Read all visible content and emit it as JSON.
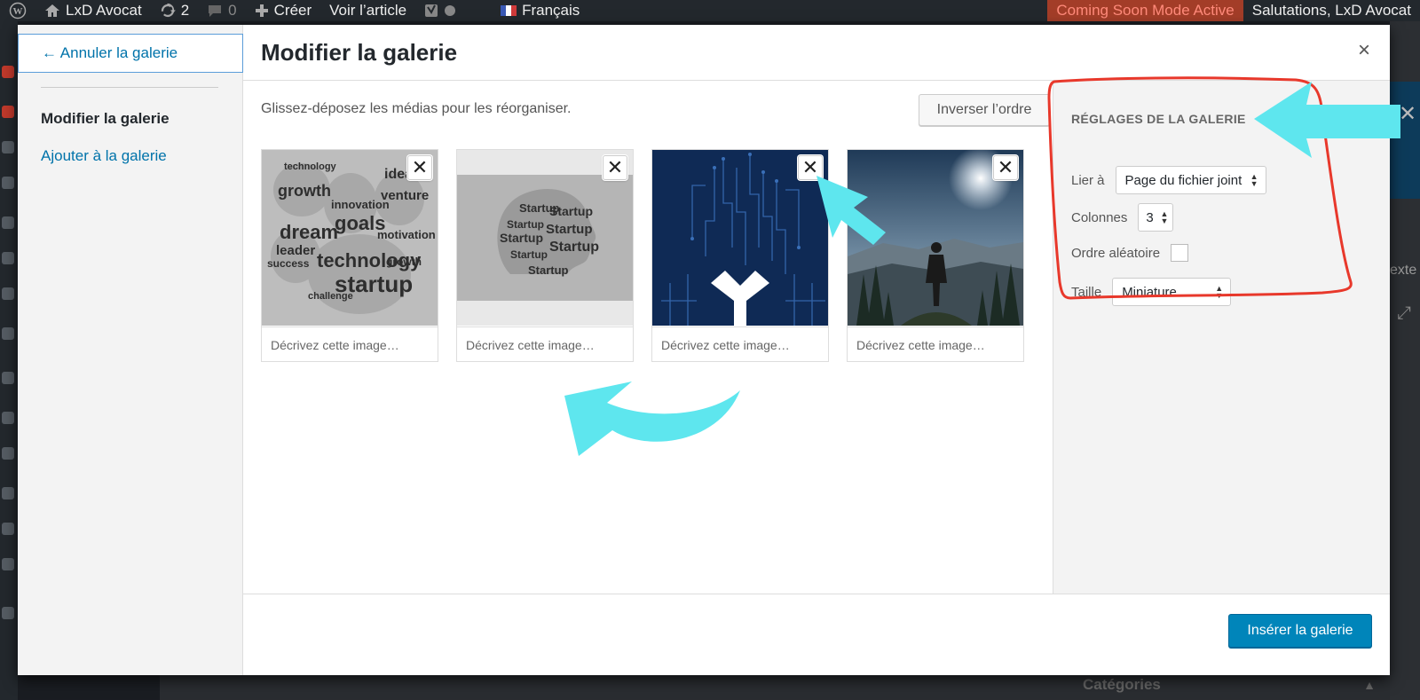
{
  "adminbar": {
    "site_name": "LxD Avocat",
    "updates_count": "2",
    "comments_count": "0",
    "new_label": "Créer",
    "view_label": "Voir l’article",
    "language": "Français",
    "coming_soon": "Coming Soon Mode Active",
    "greeting": "Salutations, LxD Avocat"
  },
  "menu": {
    "cancel_label": "← Annuler la galerie",
    "items": [
      {
        "label": "Modifier la galerie"
      },
      {
        "label": "Ajouter à la galerie"
      }
    ]
  },
  "modal": {
    "title": "Modifier la galerie",
    "close_label": "×",
    "instructions": "Glissez-déposez les médias pour les réorganiser.",
    "reverse_label": "Inverser l’ordre",
    "insert_label": "Insérer la galerie"
  },
  "attachments": [
    {
      "caption_placeholder": "Décrivez cette image…",
      "remove": "✕"
    },
    {
      "caption_placeholder": "Décrivez cette image…",
      "remove": "✕"
    },
    {
      "caption_placeholder": "Décrivez cette image…",
      "remove": "✕"
    },
    {
      "caption_placeholder": "Décrivez cette image…",
      "remove": "✕"
    }
  ],
  "thumb1_words": [
    "technology",
    "growth",
    "idea",
    "dream",
    "innovation",
    "goals",
    "venture",
    "leader",
    "motivation",
    "technology",
    "success",
    "startup",
    "challenge",
    "growth"
  ],
  "thumb2_words": [
    "Startup",
    "Startup",
    "Startup",
    "Startup",
    "Startup",
    "Startup",
    "Startup",
    "Startup"
  ],
  "settings": {
    "heading": "Réglages de la galerie",
    "link_label": "Lier à",
    "link_value": "Page du fichier joint",
    "columns_label": "Colonnes",
    "columns_value": "3",
    "random_label": "Ordre aléatoire",
    "random_checked": false,
    "size_label": "Taille",
    "size_value": "Miniature"
  },
  "background": {
    "right_text": "exte",
    "categories": "Catégories"
  },
  "colors": {
    "accent": "#0085ba",
    "link": "#0073aa",
    "annotation_arrow": "#5ee6ee",
    "annotation_box": "#e8382b"
  }
}
